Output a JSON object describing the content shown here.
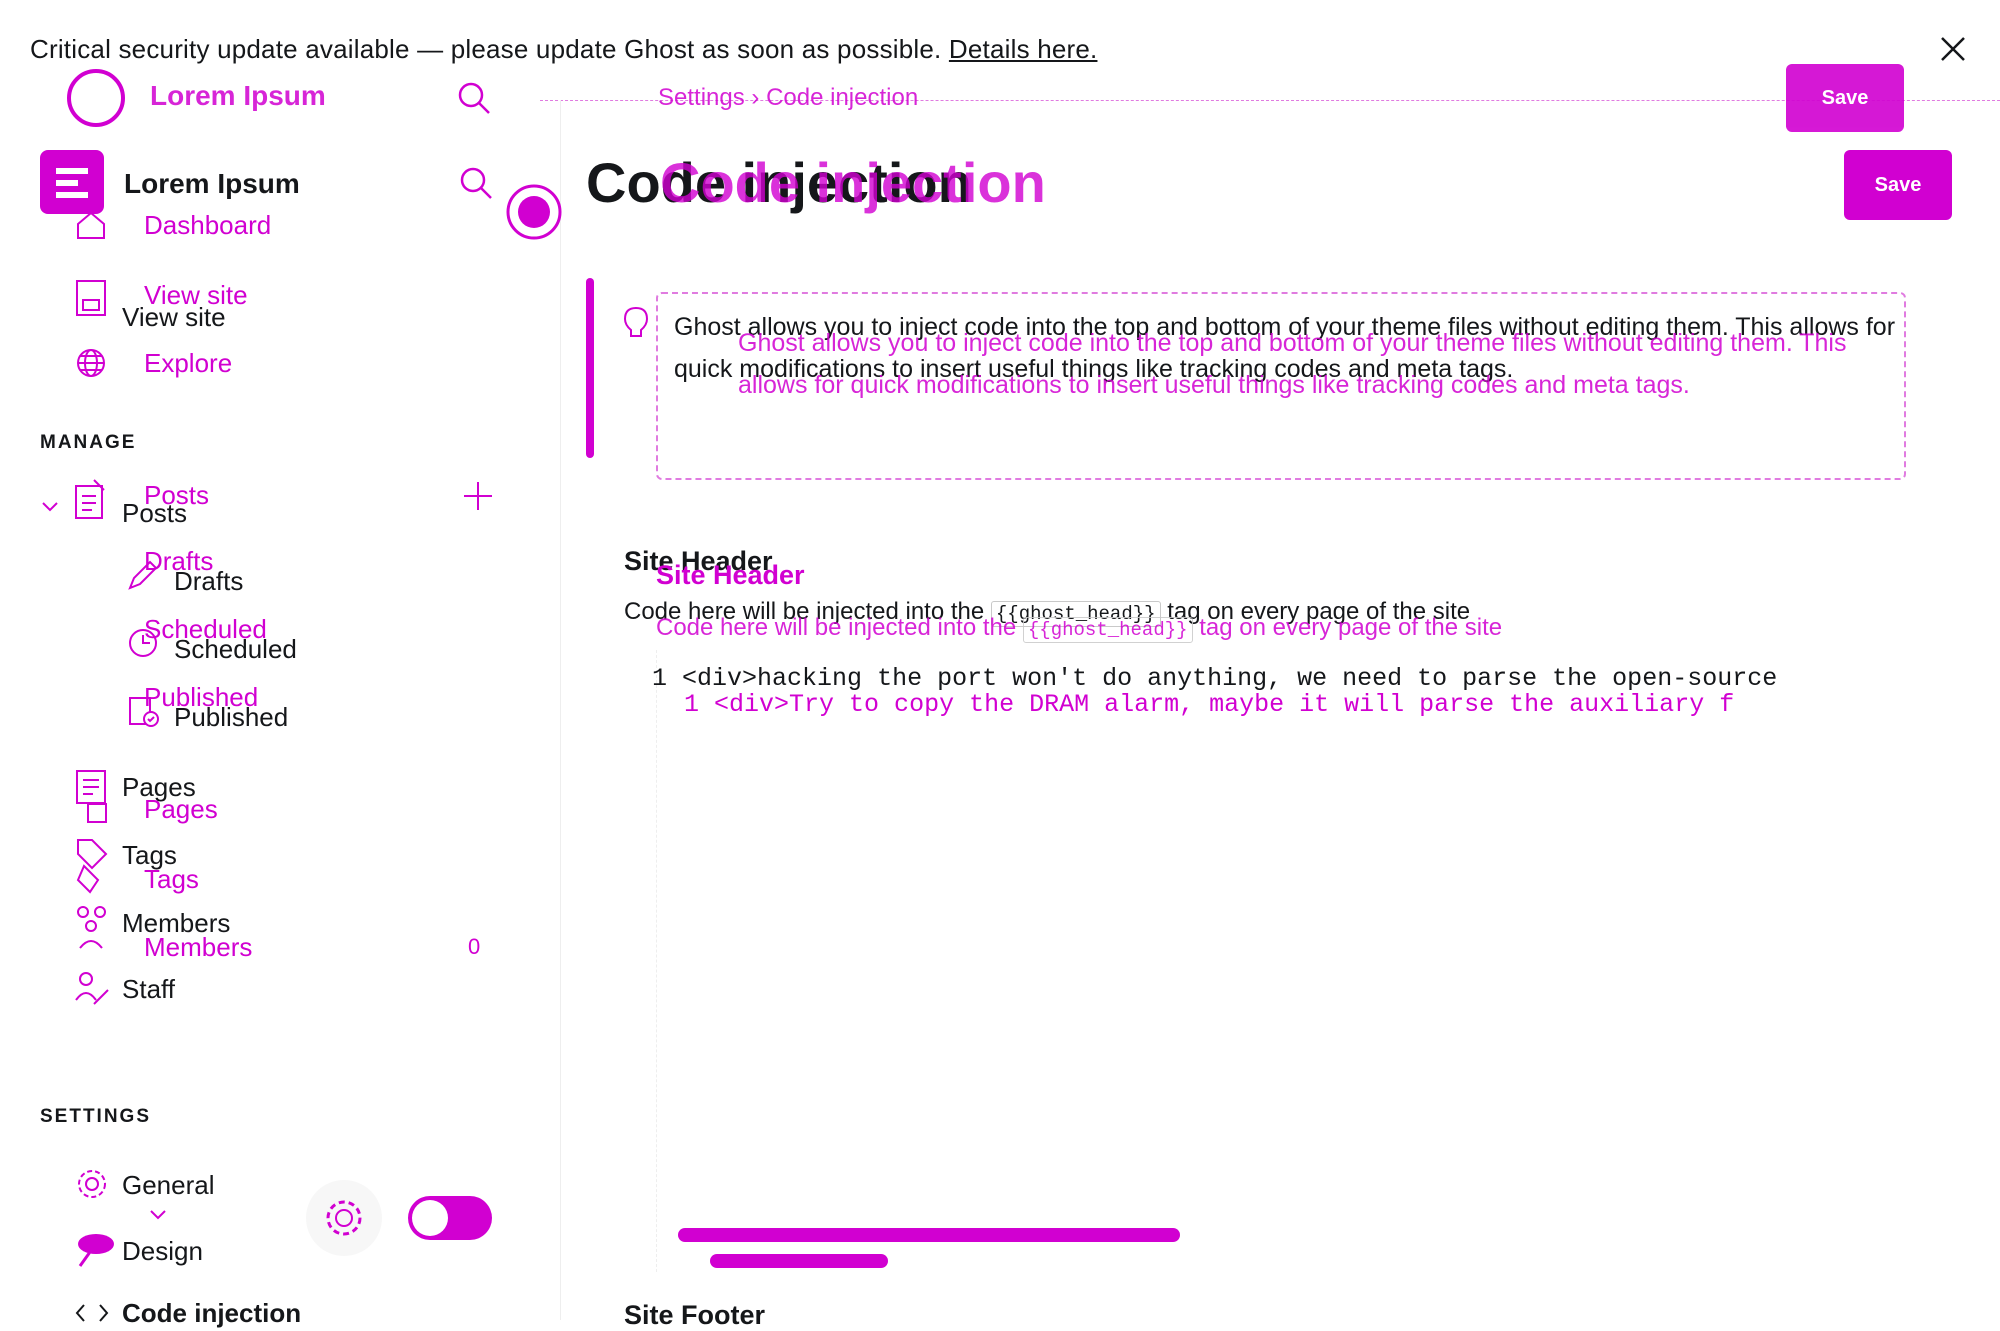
{
  "banner": {
    "text": "Critical security update available — please update Ghost as soon as possible.",
    "link": "Details here."
  },
  "site": {
    "name": "Lorem Ipsum",
    "name_secondary": "Lorem Ipsum"
  },
  "breadcrumb": {
    "parent": "Settings",
    "separator": "›",
    "current": "Code injection"
  },
  "sidebar": {
    "items_top": [
      {
        "label": "Dashboard",
        "icon": "home-icon"
      },
      {
        "label": "View site",
        "icon": "site-icon"
      },
      {
        "label": "Explore",
        "icon": "globe-icon"
      }
    ],
    "manage_title": "MANAGE",
    "posts": {
      "label": "Posts",
      "icon": "posts-icon"
    },
    "post_subitems": [
      {
        "label": "Drafts",
        "icon": "pen-icon"
      },
      {
        "label": "Scheduled",
        "icon": "clock-icon"
      },
      {
        "label": "Published",
        "icon": "published-icon"
      }
    ],
    "items_manage": [
      {
        "label": "Pages",
        "icon": "pages-icon"
      },
      {
        "label": "Tags",
        "icon": "tag-icon"
      },
      {
        "label": "Members",
        "icon": "members-icon",
        "count": "0"
      },
      {
        "label": "Staff",
        "icon": "staff-icon"
      }
    ],
    "settings_title": "SETTINGS",
    "items_settings": [
      {
        "label": "General",
        "icon": "gear-icon"
      },
      {
        "label": "Design",
        "icon": "design-icon"
      },
      {
        "label": "Code injection",
        "icon": "code-icon"
      }
    ]
  },
  "main": {
    "title": "Code injection",
    "title_ghost": "Code injection",
    "save_label": "Save",
    "notice": "Ghost allows you to inject code into the top and bottom of your theme files without editing them. This allows for quick modifications to insert useful things like tracking codes and meta tags.",
    "header_section": {
      "title": "Site Header",
      "desc_before": "Code here will be injected into the",
      "desc_code": "{{ghost_head}}",
      "desc_after": "tag on every page of the site",
      "line_number": "1",
      "code": "<div>hacking the port won't do anything, we need to parse the open-source",
      "code_ghost": "<div>Try to copy the DRAM alarm, maybe it will parse the auxiliary f"
    },
    "footer_section": {
      "title": "Site Footer"
    }
  },
  "colors": {
    "accent": "#d100d1",
    "text": "#15171a"
  }
}
